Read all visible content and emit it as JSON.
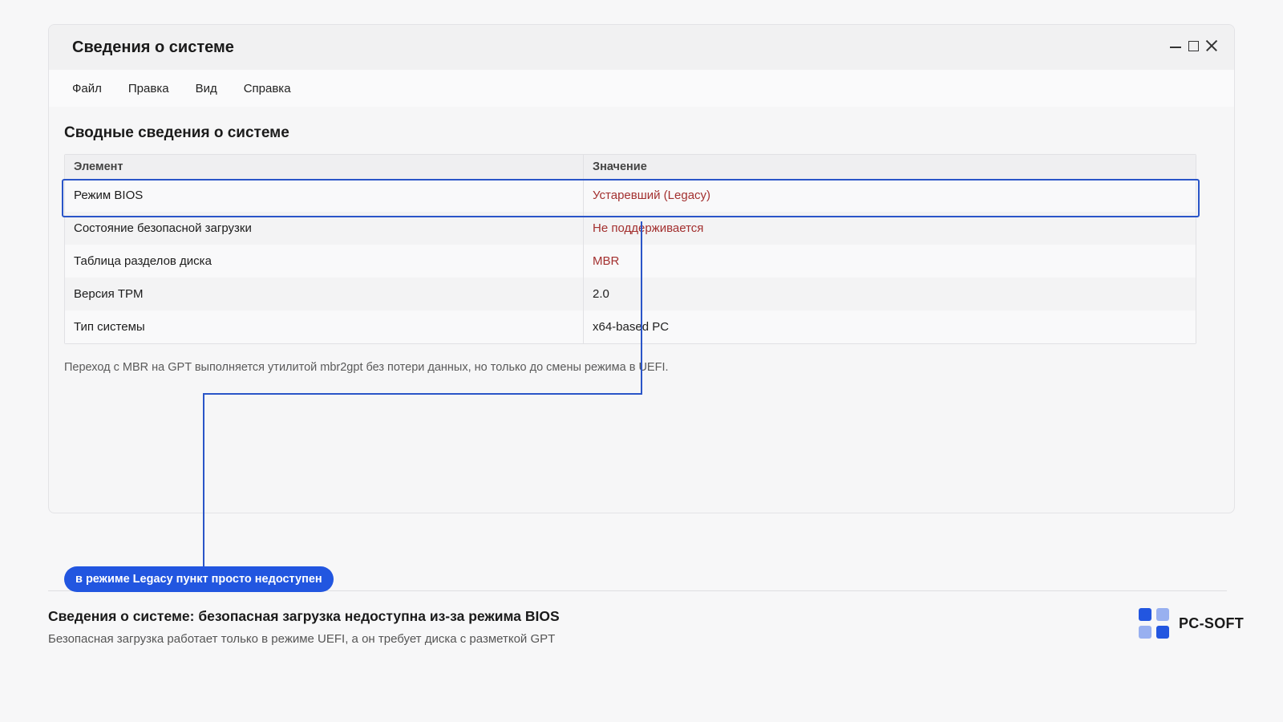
{
  "window": {
    "title": "Сведения о системе",
    "controls": [
      "minimize",
      "maximize",
      "close"
    ]
  },
  "menu": [
    "Файл",
    "Правка",
    "Вид",
    "Справка"
  ],
  "section_title": "Сводные сведения о системе",
  "table": {
    "headers": [
      "Элемент",
      "Значение"
    ],
    "rows": [
      {
        "item": "Режим BIOS",
        "value": "Устаревший (Legacy)",
        "highlight": true,
        "value_color": "#a3302f"
      },
      {
        "item": "Состояние безопасной загрузки",
        "value": "Не поддерживается",
        "value_color": "#a3302f"
      },
      {
        "item": "Таблица разделов диска",
        "value": "MBR",
        "value_color": "#a3302f"
      },
      {
        "item": "Версия TPM",
        "value": "2.0"
      },
      {
        "item": "Тип системы",
        "value": "x64-based PC"
      }
    ]
  },
  "note": "Переход с MBR на GPT выполняется утилитой mbr2gpt без потери данных, но только до смены режима в UEFI.",
  "callout": "в режиме Legacy пункт просто недоступен",
  "caption": {
    "title": "Сведения о системе: безопасная загрузка недоступна из-за режима BIOS",
    "subtitle": "Безопасная загрузка работает только в режиме UEFI, а он требует диска с разметкой GPT"
  },
  "brand": {
    "name": "PC-SOFT"
  },
  "colors": {
    "accent": "#2256e0",
    "warning_text": "#a3302f",
    "highlight_border": "#2a55c8"
  }
}
